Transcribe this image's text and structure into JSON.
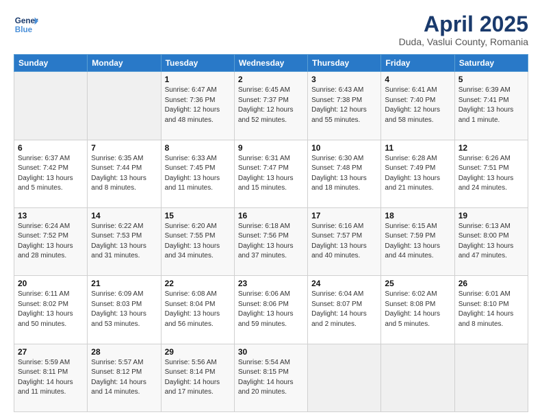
{
  "header": {
    "logo_line1": "General",
    "logo_line2": "Blue",
    "title": "April 2025",
    "subtitle": "Duda, Vaslui County, Romania"
  },
  "days_of_week": [
    "Sunday",
    "Monday",
    "Tuesday",
    "Wednesday",
    "Thursday",
    "Friday",
    "Saturday"
  ],
  "weeks": [
    [
      {
        "day": "",
        "info": ""
      },
      {
        "day": "",
        "info": ""
      },
      {
        "day": "1",
        "info": "Sunrise: 6:47 AM\nSunset: 7:36 PM\nDaylight: 12 hours and 48 minutes."
      },
      {
        "day": "2",
        "info": "Sunrise: 6:45 AM\nSunset: 7:37 PM\nDaylight: 12 hours and 52 minutes."
      },
      {
        "day": "3",
        "info": "Sunrise: 6:43 AM\nSunset: 7:38 PM\nDaylight: 12 hours and 55 minutes."
      },
      {
        "day": "4",
        "info": "Sunrise: 6:41 AM\nSunset: 7:40 PM\nDaylight: 12 hours and 58 minutes."
      },
      {
        "day": "5",
        "info": "Sunrise: 6:39 AM\nSunset: 7:41 PM\nDaylight: 13 hours and 1 minute."
      }
    ],
    [
      {
        "day": "6",
        "info": "Sunrise: 6:37 AM\nSunset: 7:42 PM\nDaylight: 13 hours and 5 minutes."
      },
      {
        "day": "7",
        "info": "Sunrise: 6:35 AM\nSunset: 7:44 PM\nDaylight: 13 hours and 8 minutes."
      },
      {
        "day": "8",
        "info": "Sunrise: 6:33 AM\nSunset: 7:45 PM\nDaylight: 13 hours and 11 minutes."
      },
      {
        "day": "9",
        "info": "Sunrise: 6:31 AM\nSunset: 7:47 PM\nDaylight: 13 hours and 15 minutes."
      },
      {
        "day": "10",
        "info": "Sunrise: 6:30 AM\nSunset: 7:48 PM\nDaylight: 13 hours and 18 minutes."
      },
      {
        "day": "11",
        "info": "Sunrise: 6:28 AM\nSunset: 7:49 PM\nDaylight: 13 hours and 21 minutes."
      },
      {
        "day": "12",
        "info": "Sunrise: 6:26 AM\nSunset: 7:51 PM\nDaylight: 13 hours and 24 minutes."
      }
    ],
    [
      {
        "day": "13",
        "info": "Sunrise: 6:24 AM\nSunset: 7:52 PM\nDaylight: 13 hours and 28 minutes."
      },
      {
        "day": "14",
        "info": "Sunrise: 6:22 AM\nSunset: 7:53 PM\nDaylight: 13 hours and 31 minutes."
      },
      {
        "day": "15",
        "info": "Sunrise: 6:20 AM\nSunset: 7:55 PM\nDaylight: 13 hours and 34 minutes."
      },
      {
        "day": "16",
        "info": "Sunrise: 6:18 AM\nSunset: 7:56 PM\nDaylight: 13 hours and 37 minutes."
      },
      {
        "day": "17",
        "info": "Sunrise: 6:16 AM\nSunset: 7:57 PM\nDaylight: 13 hours and 40 minutes."
      },
      {
        "day": "18",
        "info": "Sunrise: 6:15 AM\nSunset: 7:59 PM\nDaylight: 13 hours and 44 minutes."
      },
      {
        "day": "19",
        "info": "Sunrise: 6:13 AM\nSunset: 8:00 PM\nDaylight: 13 hours and 47 minutes."
      }
    ],
    [
      {
        "day": "20",
        "info": "Sunrise: 6:11 AM\nSunset: 8:02 PM\nDaylight: 13 hours and 50 minutes."
      },
      {
        "day": "21",
        "info": "Sunrise: 6:09 AM\nSunset: 8:03 PM\nDaylight: 13 hours and 53 minutes."
      },
      {
        "day": "22",
        "info": "Sunrise: 6:08 AM\nSunset: 8:04 PM\nDaylight: 13 hours and 56 minutes."
      },
      {
        "day": "23",
        "info": "Sunrise: 6:06 AM\nSunset: 8:06 PM\nDaylight: 13 hours and 59 minutes."
      },
      {
        "day": "24",
        "info": "Sunrise: 6:04 AM\nSunset: 8:07 PM\nDaylight: 14 hours and 2 minutes."
      },
      {
        "day": "25",
        "info": "Sunrise: 6:02 AM\nSunset: 8:08 PM\nDaylight: 14 hours and 5 minutes."
      },
      {
        "day": "26",
        "info": "Sunrise: 6:01 AM\nSunset: 8:10 PM\nDaylight: 14 hours and 8 minutes."
      }
    ],
    [
      {
        "day": "27",
        "info": "Sunrise: 5:59 AM\nSunset: 8:11 PM\nDaylight: 14 hours and 11 minutes."
      },
      {
        "day": "28",
        "info": "Sunrise: 5:57 AM\nSunset: 8:12 PM\nDaylight: 14 hours and 14 minutes."
      },
      {
        "day": "29",
        "info": "Sunrise: 5:56 AM\nSunset: 8:14 PM\nDaylight: 14 hours and 17 minutes."
      },
      {
        "day": "30",
        "info": "Sunrise: 5:54 AM\nSunset: 8:15 PM\nDaylight: 14 hours and 20 minutes."
      },
      {
        "day": "",
        "info": ""
      },
      {
        "day": "",
        "info": ""
      },
      {
        "day": "",
        "info": ""
      }
    ]
  ]
}
